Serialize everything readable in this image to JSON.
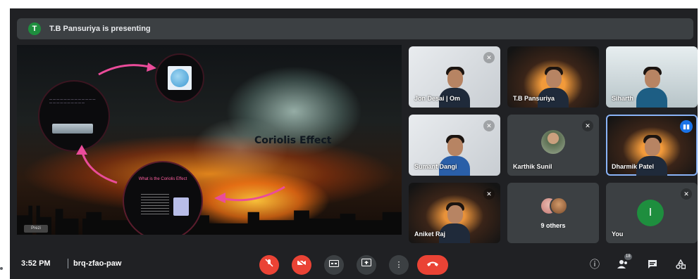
{
  "banner": {
    "avatar_letter": "T",
    "text": "T.B Pansuriya is presenting"
  },
  "presentation": {
    "title": "Coriolis Effect",
    "question_text": "What is the Coriolis Effect",
    "brand_tag": "Prezi"
  },
  "participants": [
    {
      "name": "Jon Desai | Om",
      "muted": true
    },
    {
      "name": "T.B Pansuriya",
      "muted": false
    },
    {
      "name": "Siharth",
      "muted": false
    },
    {
      "name": "Sumant Dangi",
      "muted": true
    },
    {
      "name": "Karthik Sunil",
      "muted": true
    },
    {
      "name": "Dharmik Patel",
      "muted": false,
      "speaking": true
    },
    {
      "name": "Aniket Raj",
      "muted": true
    },
    {
      "name": "9 others"
    },
    {
      "name": "You",
      "avatar_letter": "I",
      "muted": true
    }
  ],
  "bottom_bar": {
    "time": "3:52 PM",
    "meeting_code": "brq-zfao-paw",
    "people_badge": "18"
  },
  "colors": {
    "background": "#202124",
    "tile": "#3c4043",
    "red": "#ea4335",
    "accent": "#8ab4f8",
    "you_avatar": "#1e8e3e"
  },
  "icons": [
    "mic-off-icon",
    "camera-off-icon",
    "captions-icon",
    "present-icon",
    "more-icon",
    "end-call-icon",
    "info-icon",
    "people-icon",
    "chat-icon",
    "activities-icon"
  ]
}
